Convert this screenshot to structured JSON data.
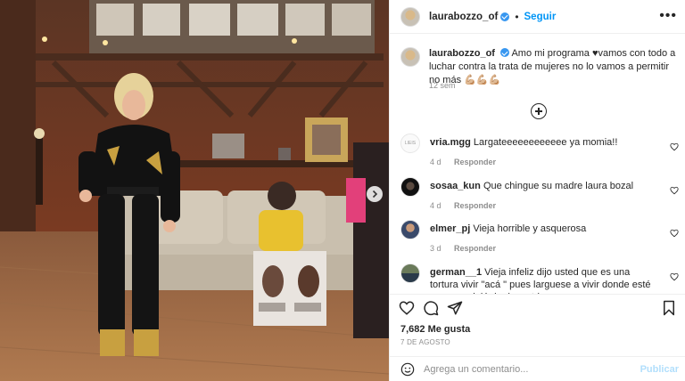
{
  "post": {
    "username": "laurabozzo_of",
    "follow_label": "Seguir",
    "more_label": "•••",
    "caption_username": "laurabozzo_of",
    "caption_text": "Amo mi programa ♥vamos con todo a luchar contra la trata de mujeres no lo vamos a permitir no más 💪🏼💪🏼💪🏼",
    "caption_time": "12 sem",
    "likes": "7,682 Me gusta",
    "date": "7 DE AGOSTO",
    "comment_placeholder": "Agrega un comentario...",
    "publish_label": "Publicar"
  },
  "comments": [
    {
      "username": "vria.mgg",
      "text": "Largateeeeeeeeeeee ya momia!!",
      "time": "4 d",
      "reply": "Responder"
    },
    {
      "username": "sosaa_kun",
      "text": "Que chingue su madre laura bozal",
      "time": "4 d",
      "reply": "Responder"
    },
    {
      "username": "elmer_pj",
      "text": "Vieja horrible y asquerosa",
      "time": "3 d",
      "reply": "Responder"
    },
    {
      "username": "german__1",
      "text": "Vieja infeliz dijo usted que es una tortura vivir \"acá \" pues larguese a vivir donde esté en paz y dejé de despotricar",
      "time": "",
      "reply": ""
    }
  ],
  "avatar_small_label": "LIEIS",
  "icons": {
    "verified": "verified-badge-icon",
    "more": "more-options-icon",
    "load_more": "plus-circle-icon",
    "like": "heart-icon",
    "comment": "comment-bubble-icon",
    "share": "paper-plane-icon",
    "save": "bookmark-icon",
    "emoji": "smiley-icon",
    "next": "chevron-right-icon"
  },
  "colors": {
    "link_blue": "#0095f6",
    "verified_blue": "#3897f0",
    "muted": "#8e8e8e",
    "publish_disabled": "#b2dffc"
  }
}
